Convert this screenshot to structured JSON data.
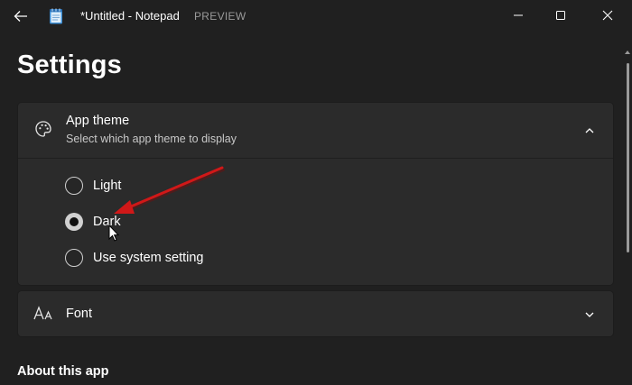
{
  "window": {
    "title": "*Untitled - Notepad",
    "badge": "PREVIEW",
    "back_icon": "back-arrow-icon",
    "app_icon": "notepad-icon",
    "controls": [
      "minimize-icon",
      "maximize-icon",
      "close-icon"
    ]
  },
  "page": {
    "title": "Settings"
  },
  "theme_card": {
    "icon": "palette-icon",
    "title": "App theme",
    "description": "Select which app theme to display",
    "expanded": true,
    "options": [
      {
        "label": "Light",
        "checked": false
      },
      {
        "label": "Dark",
        "checked": true
      },
      {
        "label": "Use system setting",
        "checked": false
      }
    ]
  },
  "font_card": {
    "icon": "font-icon",
    "title": "Font",
    "expanded": false
  },
  "about": {
    "title": "About this app"
  },
  "colors": {
    "background": "#202020",
    "card": "#2b2b2b",
    "annotation_arrow": "#d01818"
  }
}
